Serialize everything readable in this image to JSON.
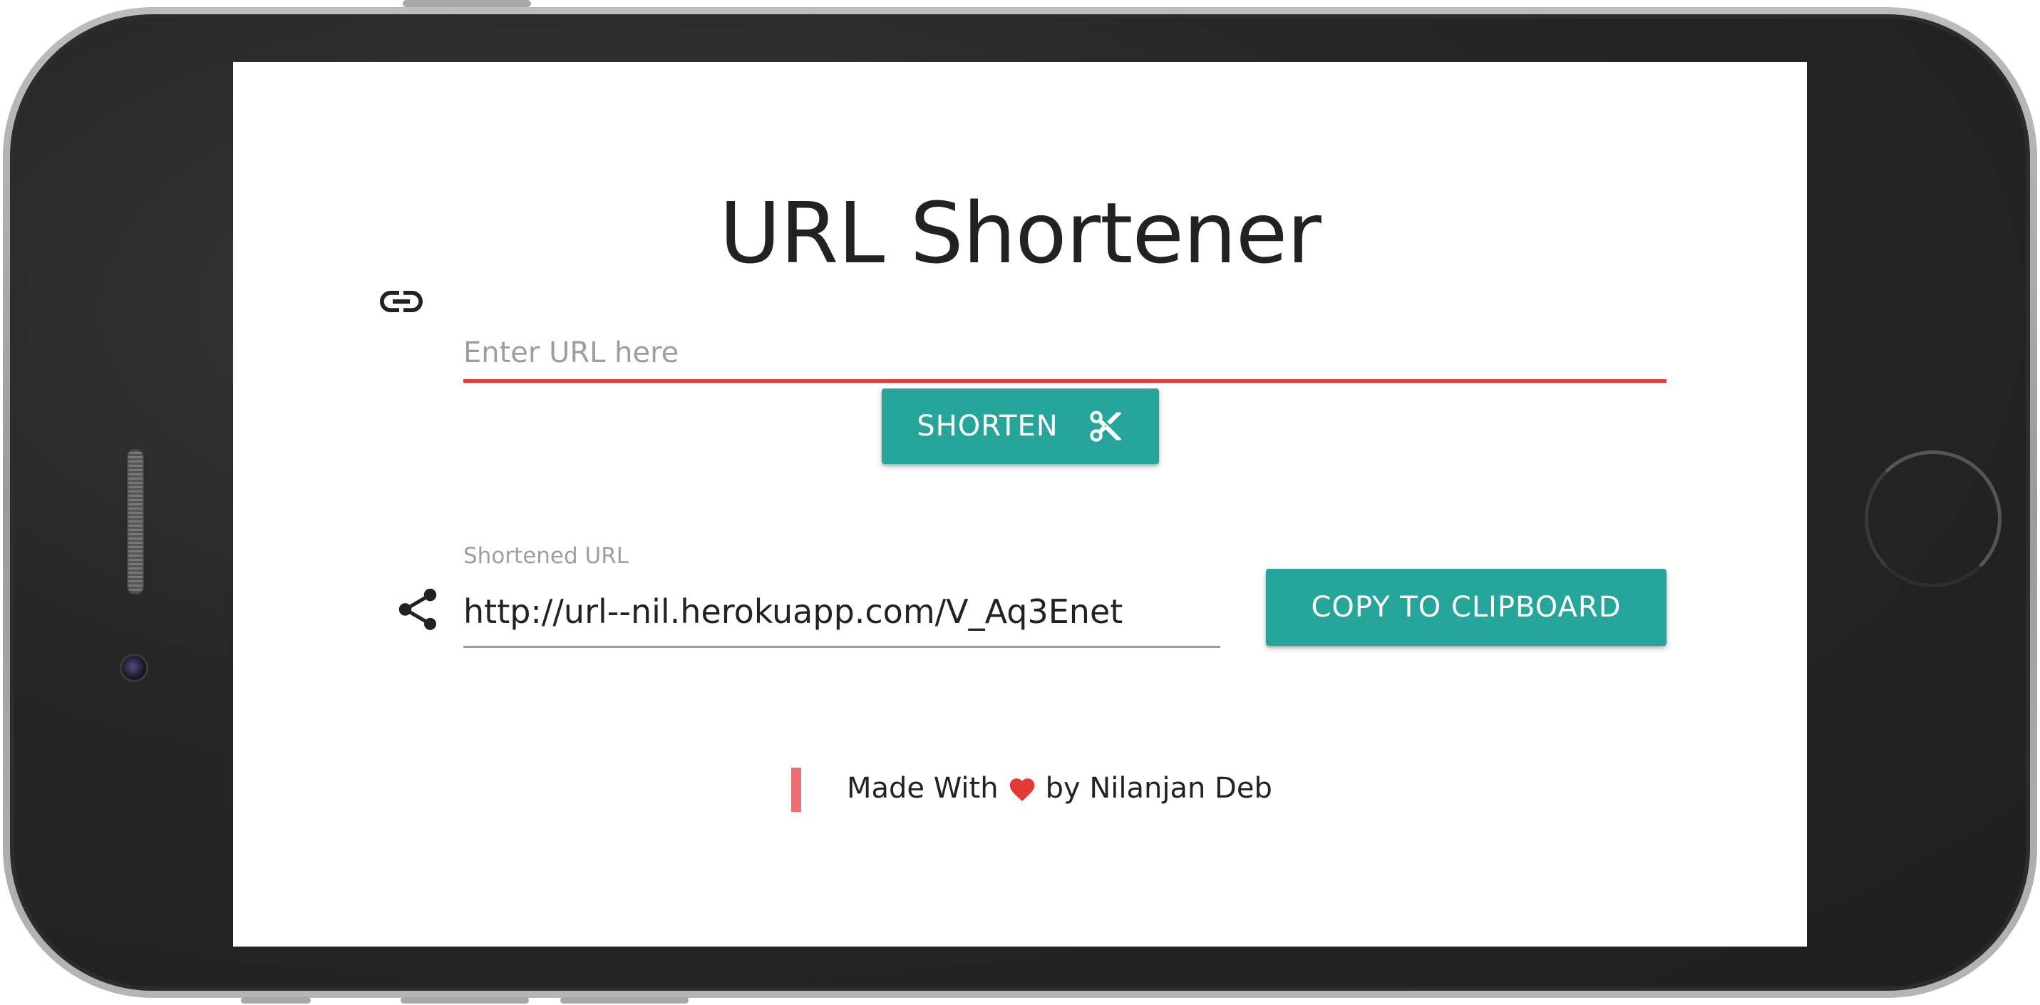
{
  "page": {
    "title": "URL Shortener"
  },
  "url_input": {
    "placeholder": "Enter URL here",
    "value": "",
    "underline_color": "#e53935"
  },
  "shorten_button": {
    "label": "SHORTEN",
    "icon": "scissors-icon",
    "color": "#26a69a"
  },
  "short_url": {
    "label": "Shortened URL",
    "value": "http://url--nil.herokuapp.com/V_Aq3Enet",
    "icon": "share-icon"
  },
  "copy_button": {
    "label": "COPY TO CLIPBOARD",
    "color": "#26a69a"
  },
  "footer": {
    "made_with": "Made With",
    "by_text": "by Nilanjan Deb",
    "heart_icon": "heart-icon",
    "heart_color": "#e53935",
    "bar_color": "#ec6f73"
  },
  "icons": {
    "link": "link-icon",
    "scissors": "scissors-icon",
    "share": "share-icon",
    "heart": "heart-icon"
  }
}
